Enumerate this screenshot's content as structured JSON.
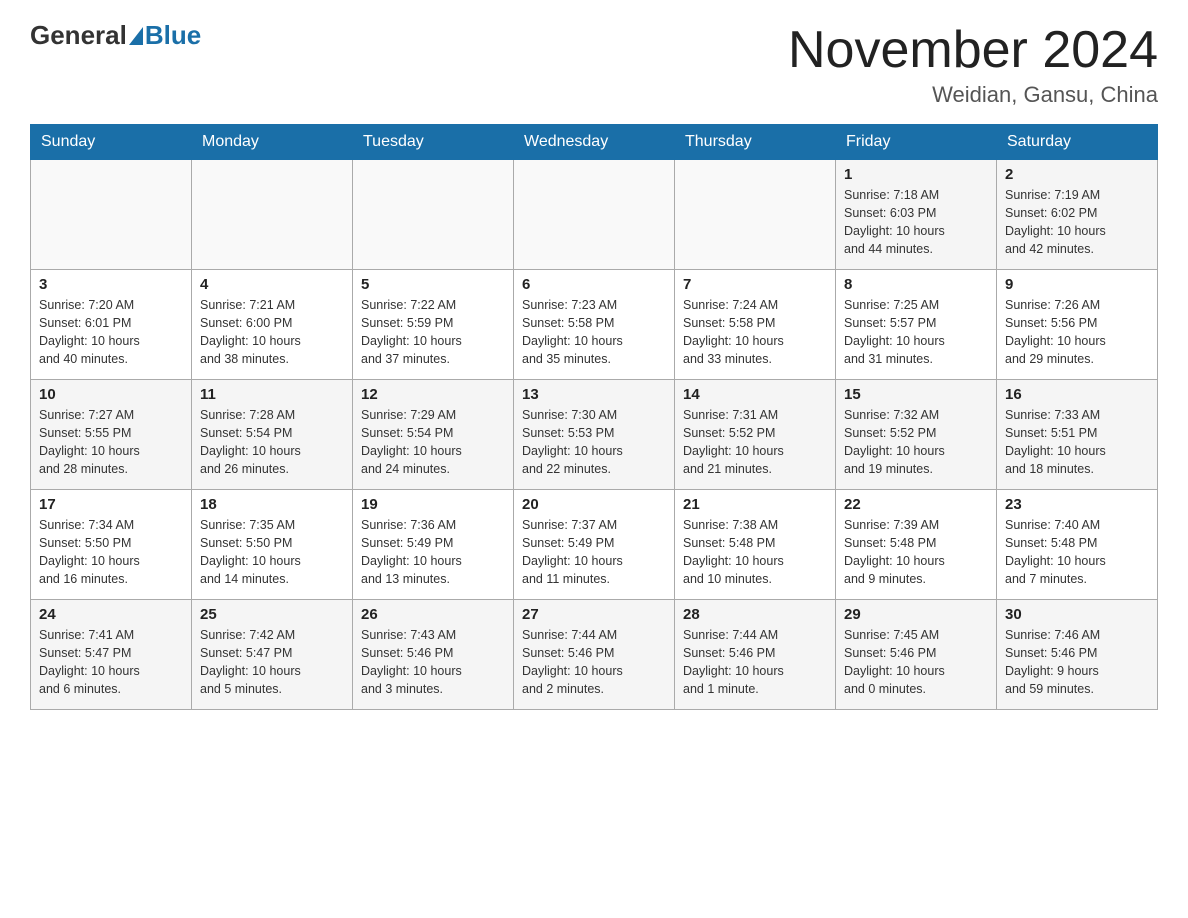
{
  "header": {
    "logo_general": "General",
    "logo_blue": "Blue",
    "month_title": "November 2024",
    "location": "Weidian, Gansu, China"
  },
  "days_of_week": [
    "Sunday",
    "Monday",
    "Tuesday",
    "Wednesday",
    "Thursday",
    "Friday",
    "Saturday"
  ],
  "weeks": [
    [
      {
        "day": "",
        "info": ""
      },
      {
        "day": "",
        "info": ""
      },
      {
        "day": "",
        "info": ""
      },
      {
        "day": "",
        "info": ""
      },
      {
        "day": "",
        "info": ""
      },
      {
        "day": "1",
        "info": "Sunrise: 7:18 AM\nSunset: 6:03 PM\nDaylight: 10 hours\nand 44 minutes."
      },
      {
        "day": "2",
        "info": "Sunrise: 7:19 AM\nSunset: 6:02 PM\nDaylight: 10 hours\nand 42 minutes."
      }
    ],
    [
      {
        "day": "3",
        "info": "Sunrise: 7:20 AM\nSunset: 6:01 PM\nDaylight: 10 hours\nand 40 minutes."
      },
      {
        "day": "4",
        "info": "Sunrise: 7:21 AM\nSunset: 6:00 PM\nDaylight: 10 hours\nand 38 minutes."
      },
      {
        "day": "5",
        "info": "Sunrise: 7:22 AM\nSunset: 5:59 PM\nDaylight: 10 hours\nand 37 minutes."
      },
      {
        "day": "6",
        "info": "Sunrise: 7:23 AM\nSunset: 5:58 PM\nDaylight: 10 hours\nand 35 minutes."
      },
      {
        "day": "7",
        "info": "Sunrise: 7:24 AM\nSunset: 5:58 PM\nDaylight: 10 hours\nand 33 minutes."
      },
      {
        "day": "8",
        "info": "Sunrise: 7:25 AM\nSunset: 5:57 PM\nDaylight: 10 hours\nand 31 minutes."
      },
      {
        "day": "9",
        "info": "Sunrise: 7:26 AM\nSunset: 5:56 PM\nDaylight: 10 hours\nand 29 minutes."
      }
    ],
    [
      {
        "day": "10",
        "info": "Sunrise: 7:27 AM\nSunset: 5:55 PM\nDaylight: 10 hours\nand 28 minutes."
      },
      {
        "day": "11",
        "info": "Sunrise: 7:28 AM\nSunset: 5:54 PM\nDaylight: 10 hours\nand 26 minutes."
      },
      {
        "day": "12",
        "info": "Sunrise: 7:29 AM\nSunset: 5:54 PM\nDaylight: 10 hours\nand 24 minutes."
      },
      {
        "day": "13",
        "info": "Sunrise: 7:30 AM\nSunset: 5:53 PM\nDaylight: 10 hours\nand 22 minutes."
      },
      {
        "day": "14",
        "info": "Sunrise: 7:31 AM\nSunset: 5:52 PM\nDaylight: 10 hours\nand 21 minutes."
      },
      {
        "day": "15",
        "info": "Sunrise: 7:32 AM\nSunset: 5:52 PM\nDaylight: 10 hours\nand 19 minutes."
      },
      {
        "day": "16",
        "info": "Sunrise: 7:33 AM\nSunset: 5:51 PM\nDaylight: 10 hours\nand 18 minutes."
      }
    ],
    [
      {
        "day": "17",
        "info": "Sunrise: 7:34 AM\nSunset: 5:50 PM\nDaylight: 10 hours\nand 16 minutes."
      },
      {
        "day": "18",
        "info": "Sunrise: 7:35 AM\nSunset: 5:50 PM\nDaylight: 10 hours\nand 14 minutes."
      },
      {
        "day": "19",
        "info": "Sunrise: 7:36 AM\nSunset: 5:49 PM\nDaylight: 10 hours\nand 13 minutes."
      },
      {
        "day": "20",
        "info": "Sunrise: 7:37 AM\nSunset: 5:49 PM\nDaylight: 10 hours\nand 11 minutes."
      },
      {
        "day": "21",
        "info": "Sunrise: 7:38 AM\nSunset: 5:48 PM\nDaylight: 10 hours\nand 10 minutes."
      },
      {
        "day": "22",
        "info": "Sunrise: 7:39 AM\nSunset: 5:48 PM\nDaylight: 10 hours\nand 9 minutes."
      },
      {
        "day": "23",
        "info": "Sunrise: 7:40 AM\nSunset: 5:48 PM\nDaylight: 10 hours\nand 7 minutes."
      }
    ],
    [
      {
        "day": "24",
        "info": "Sunrise: 7:41 AM\nSunset: 5:47 PM\nDaylight: 10 hours\nand 6 minutes."
      },
      {
        "day": "25",
        "info": "Sunrise: 7:42 AM\nSunset: 5:47 PM\nDaylight: 10 hours\nand 5 minutes."
      },
      {
        "day": "26",
        "info": "Sunrise: 7:43 AM\nSunset: 5:46 PM\nDaylight: 10 hours\nand 3 minutes."
      },
      {
        "day": "27",
        "info": "Sunrise: 7:44 AM\nSunset: 5:46 PM\nDaylight: 10 hours\nand 2 minutes."
      },
      {
        "day": "28",
        "info": "Sunrise: 7:44 AM\nSunset: 5:46 PM\nDaylight: 10 hours\nand 1 minute."
      },
      {
        "day": "29",
        "info": "Sunrise: 7:45 AM\nSunset: 5:46 PM\nDaylight: 10 hours\nand 0 minutes."
      },
      {
        "day": "30",
        "info": "Sunrise: 7:46 AM\nSunset: 5:46 PM\nDaylight: 9 hours\nand 59 minutes."
      }
    ]
  ]
}
